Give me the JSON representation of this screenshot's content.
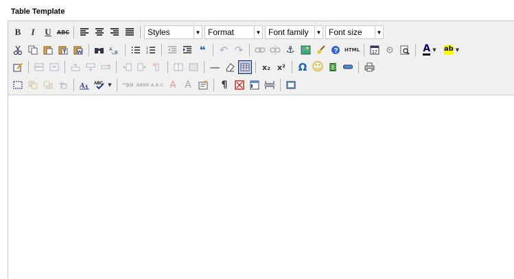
{
  "title": "Table Template",
  "selects": {
    "styles": "Styles",
    "format": "Format",
    "font_family": "Font family",
    "font_size": "Font size"
  },
  "glyphs": {
    "bold": "B",
    "italic": "I",
    "underline": "U",
    "strike": "ABC",
    "html": "HTML",
    "blockquote": "❝",
    "omega": "Ω",
    "smiley": "☺",
    "pilcrow": "¶",
    "font_color": "A",
    "sub": "x₂",
    "sup": "x²",
    "anchor": "⚓",
    "help": "?",
    "clock": "⏲",
    "undo": "↶",
    "redo": "↷",
    "cite": "“99",
    "abbr": "ABBR",
    "acronym": "A.B.C.",
    "del": "A",
    "ins": "A",
    "hr": "—"
  },
  "colors": {
    "toolbar_bg": "#f0f0ee",
    "border": "#c8c8c8",
    "active_btn": "#c2cbe0"
  }
}
